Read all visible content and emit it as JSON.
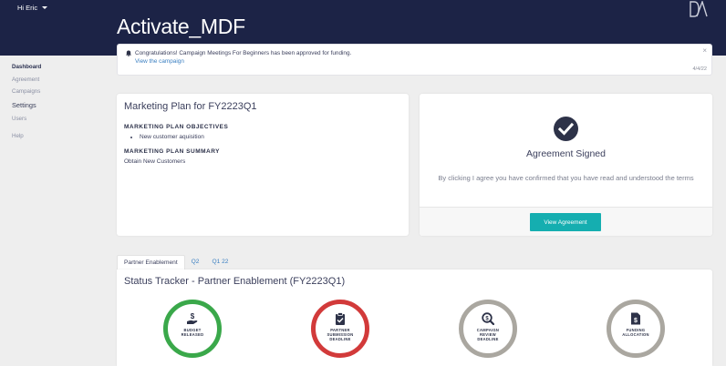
{
  "header": {
    "greeting": "Hi Eric",
    "title": "Activate_MDF"
  },
  "sidebar": {
    "items": [
      {
        "label": "Dashboard"
      },
      {
        "label": "Agreement"
      },
      {
        "label": "Campaigns"
      },
      {
        "label": "Settings"
      },
      {
        "label": "Users"
      },
      {
        "label": "Help"
      }
    ]
  },
  "notification": {
    "message": "Congratulations! Campaign Meetings For Beginners has been approved for funding.",
    "link": "View the campaign",
    "date": "4/4/22",
    "close": "×"
  },
  "plan": {
    "title": "Marketing Plan for FY2223Q1",
    "objectives_heading": "MARKETING PLAN OBJECTIVES",
    "objectives": [
      "New customer aquisition"
    ],
    "summary_heading": "MARKETING PLAN SUMMARY",
    "summary": "Obtain New Customers"
  },
  "agreement": {
    "title": "Agreement Signed",
    "body": "By clicking I agree you have confirmed that you have read and understood the terms",
    "button": "View Agreement"
  },
  "tabs": [
    {
      "label": "Partner Enablement"
    },
    {
      "label": "Q2"
    },
    {
      "label": "Q1 22"
    }
  ],
  "tracker": {
    "title": "Status Tracker - Partner Enablement (FY2223Q1)",
    "stages": [
      {
        "label_line1": "BUDGET",
        "label_line2": "RELEASED",
        "label_line3": "",
        "icon": "hand-dollar-icon",
        "color": "#3aa84a"
      },
      {
        "label_line1": "PARTNER",
        "label_line2": "SUBMISSION",
        "label_line3": "DEADLINE",
        "icon": "clipboard-check-icon",
        "color": "#d23a3a"
      },
      {
        "label_line1": "CAMPAIGN",
        "label_line2": "REVIEW",
        "label_line3": "DEADLINE",
        "icon": "magnify-dollar-icon",
        "color": "#aaa7a0"
      },
      {
        "label_line1": "FUNDING",
        "label_line2": "ALLOCATION",
        "label_line3": "",
        "icon": "document-dollar-icon",
        "color": "#aaa7a0"
      }
    ]
  },
  "colors": {
    "header_bg": "#1c2346",
    "accent_teal": "#15aeb0",
    "link_blue": "#3a7fc1"
  }
}
